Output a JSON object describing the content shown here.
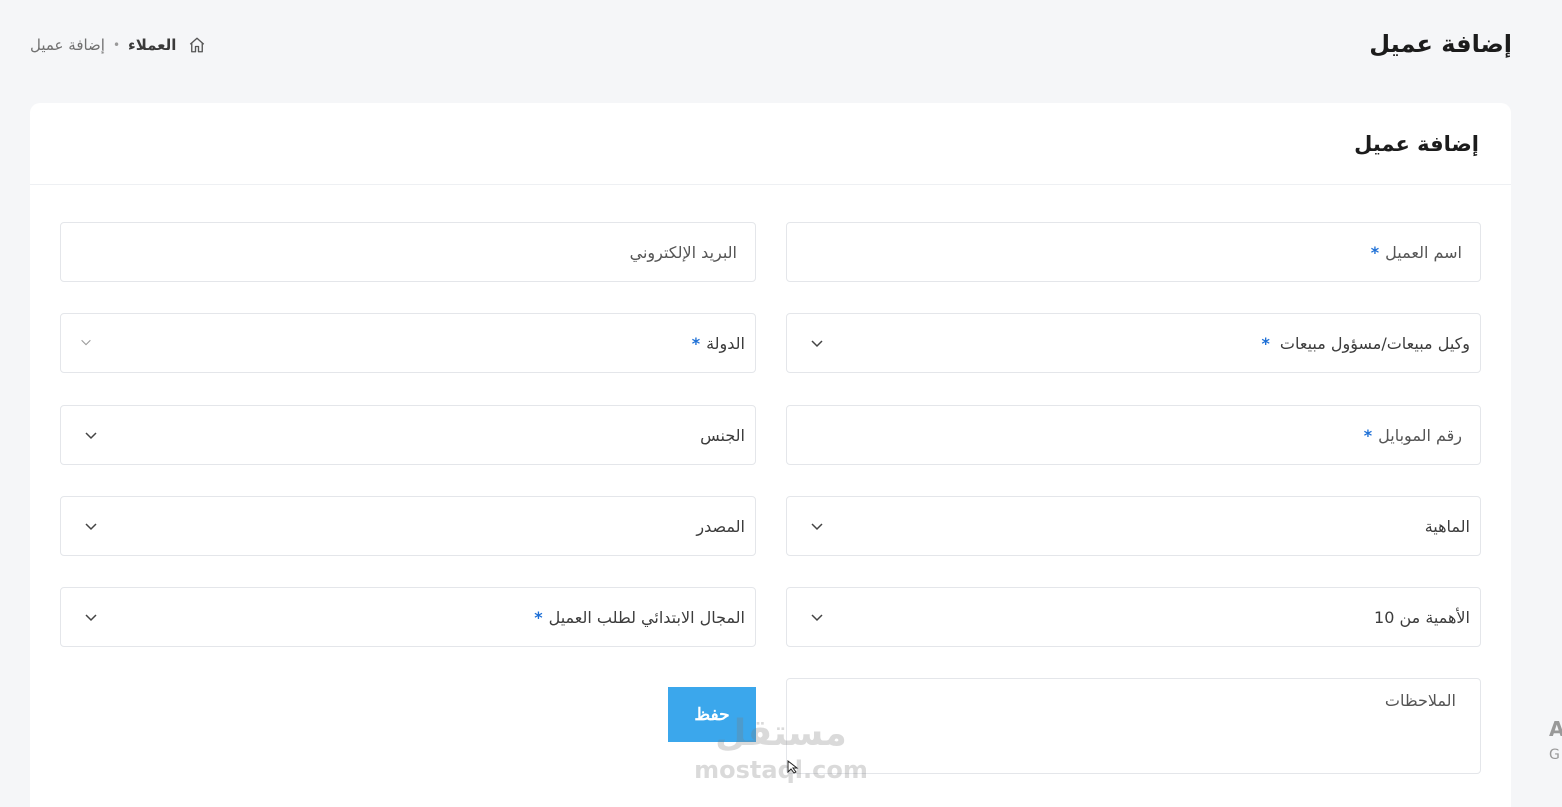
{
  "header": {
    "title": "إضافة عميل"
  },
  "breadcrumb": {
    "parent": "العملاء",
    "current": "إضافة عميل"
  },
  "card": {
    "title": "إضافة عميل"
  },
  "form": {
    "customer_name": {
      "placeholder": "اسم العميل",
      "required_mark": "*"
    },
    "email": {
      "placeholder": "البريد الإلكتروني"
    },
    "sales_agent": {
      "label": "وكيل مبيعات/مسؤول مبيعات",
      "required_mark": "*"
    },
    "country": {
      "label": "الدولة",
      "required_mark": "*"
    },
    "mobile": {
      "placeholder": "رقم الموبايل",
      "required_mark": "*"
    },
    "gender": {
      "label": "الجنس"
    },
    "nature": {
      "label": "الماهية"
    },
    "source": {
      "label": "المصدر"
    },
    "importance": {
      "label": "الأهمية من 10"
    },
    "initial_field": {
      "label": "المجال الابتدائي لطلب العميل",
      "required_mark": "*"
    },
    "notes": {
      "placeholder": "الملاحظات"
    },
    "save_label": "حفظ"
  },
  "watermark": {
    "arabic": "مستقل",
    "latin": "mostaql.com"
  },
  "edge": {
    "line1": "A",
    "line2": "G"
  },
  "colors": {
    "primary_button": "#3ba7ec",
    "required": "#1d6fd6",
    "background": "#f5f6f8"
  },
  "icons": {
    "home": "home-icon",
    "chevron": "chevron-down-icon"
  }
}
